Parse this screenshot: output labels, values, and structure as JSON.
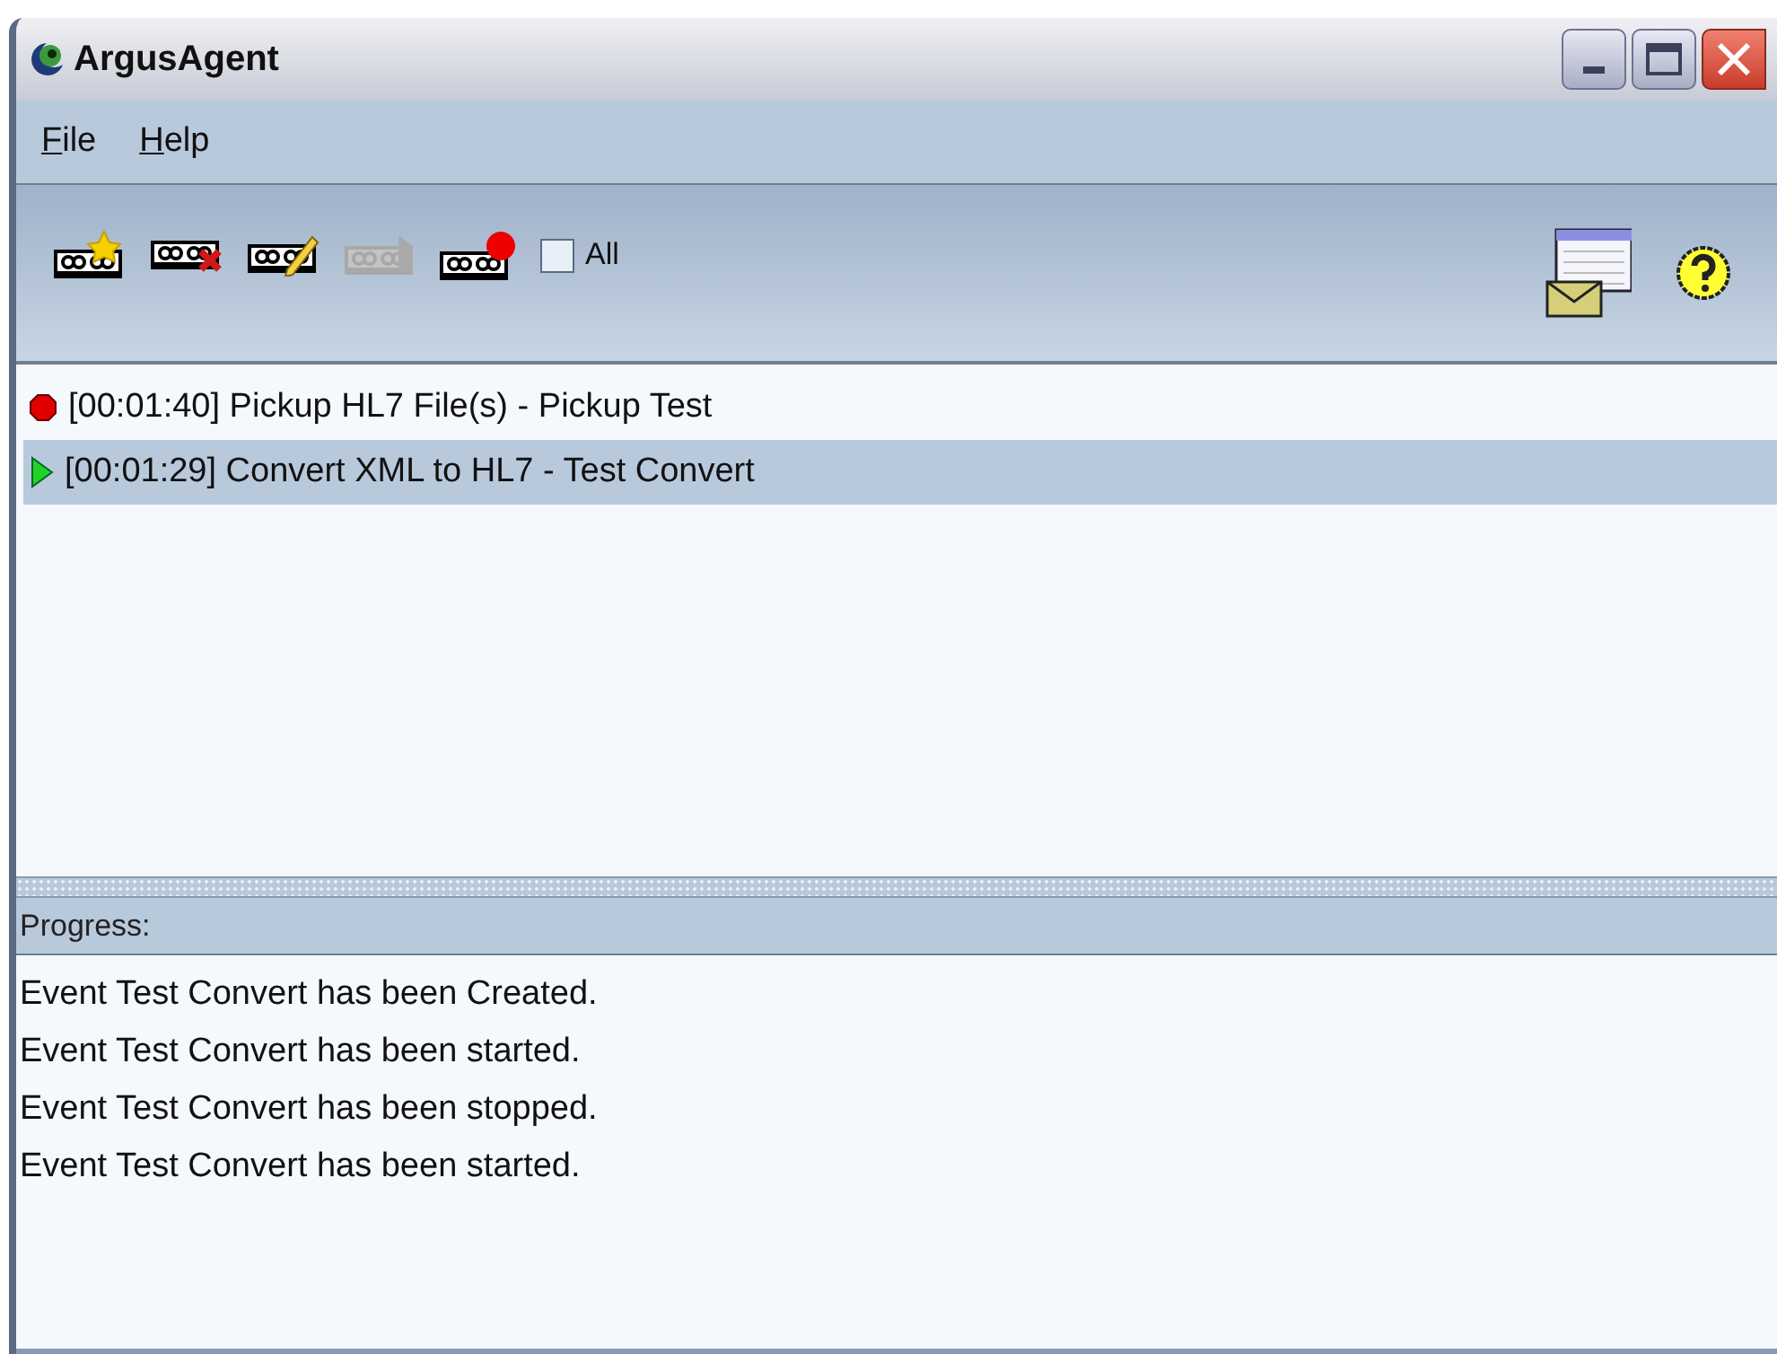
{
  "window": {
    "title": "ArgusAgent"
  },
  "menu": [
    {
      "label": "File"
    },
    {
      "label": "Help"
    }
  ],
  "toolbar": [
    {
      "kind": "new",
      "disabled": false
    },
    {
      "kind": "delete",
      "disabled": false
    },
    {
      "kind": "edit",
      "disabled": false
    },
    {
      "kind": "start",
      "disabled": true
    },
    {
      "kind": "stop",
      "disabled": false
    }
  ],
  "all_checkbox": {
    "label": "All",
    "checked": false
  },
  "events": [
    {
      "kind": "stopped",
      "text": "[00:01:40] Pickup HL7 File(s) - Pickup Test",
      "selected": false
    },
    {
      "kind": "running",
      "text": "[00:01:29] Convert XML to HL7 - Test Convert",
      "selected": true
    }
  ],
  "progress": {
    "label": "Progress:",
    "lines": [
      "Event Test Convert has been Created.",
      "Event Test Convert has been started.",
      "Event Test Convert has been stopped.",
      "Event Test Convert has been started."
    ]
  }
}
